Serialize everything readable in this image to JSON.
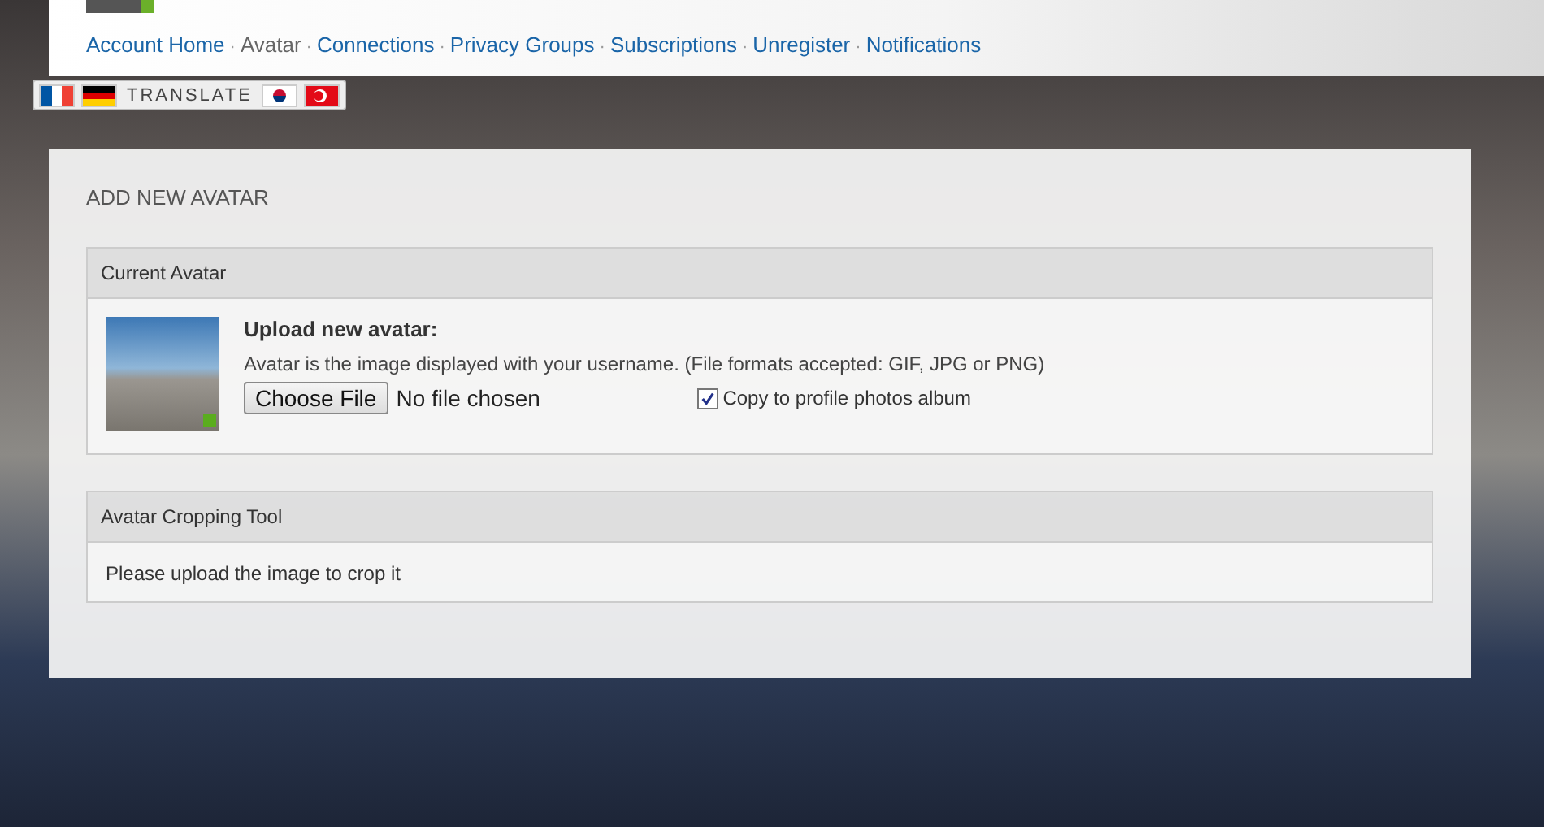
{
  "nav_separator": "·",
  "nav": [
    {
      "label": "Account Home",
      "selected": false
    },
    {
      "label": "Avatar",
      "selected": true
    },
    {
      "label": "Connections",
      "selected": false
    },
    {
      "label": "Privacy Groups",
      "selected": false
    },
    {
      "label": "Subscriptions",
      "selected": false
    },
    {
      "label": "Unregister",
      "selected": false
    },
    {
      "label": "Notifications",
      "selected": false
    }
  ],
  "translate": {
    "label": "TRANSLATE",
    "flags": [
      {
        "kind": "france"
      },
      {
        "kind": "germany"
      },
      {
        "kind": "korea"
      },
      {
        "kind": "turkey"
      }
    ]
  },
  "panel": {
    "title": "ADD NEW AVATAR",
    "current": {
      "header": "Current Avatar",
      "upload_title": "Upload new avatar:",
      "description": "Avatar is the image displayed with your username. (File formats accepted: GIF, JPG or PNG)",
      "button": "Choose File",
      "file_status": "No file chosen",
      "copy_label": "Copy to profile photos album",
      "copy_checked": true
    },
    "cropping": {
      "header": "Avatar Cropping Tool",
      "message": "Please upload the image to crop it"
    }
  }
}
